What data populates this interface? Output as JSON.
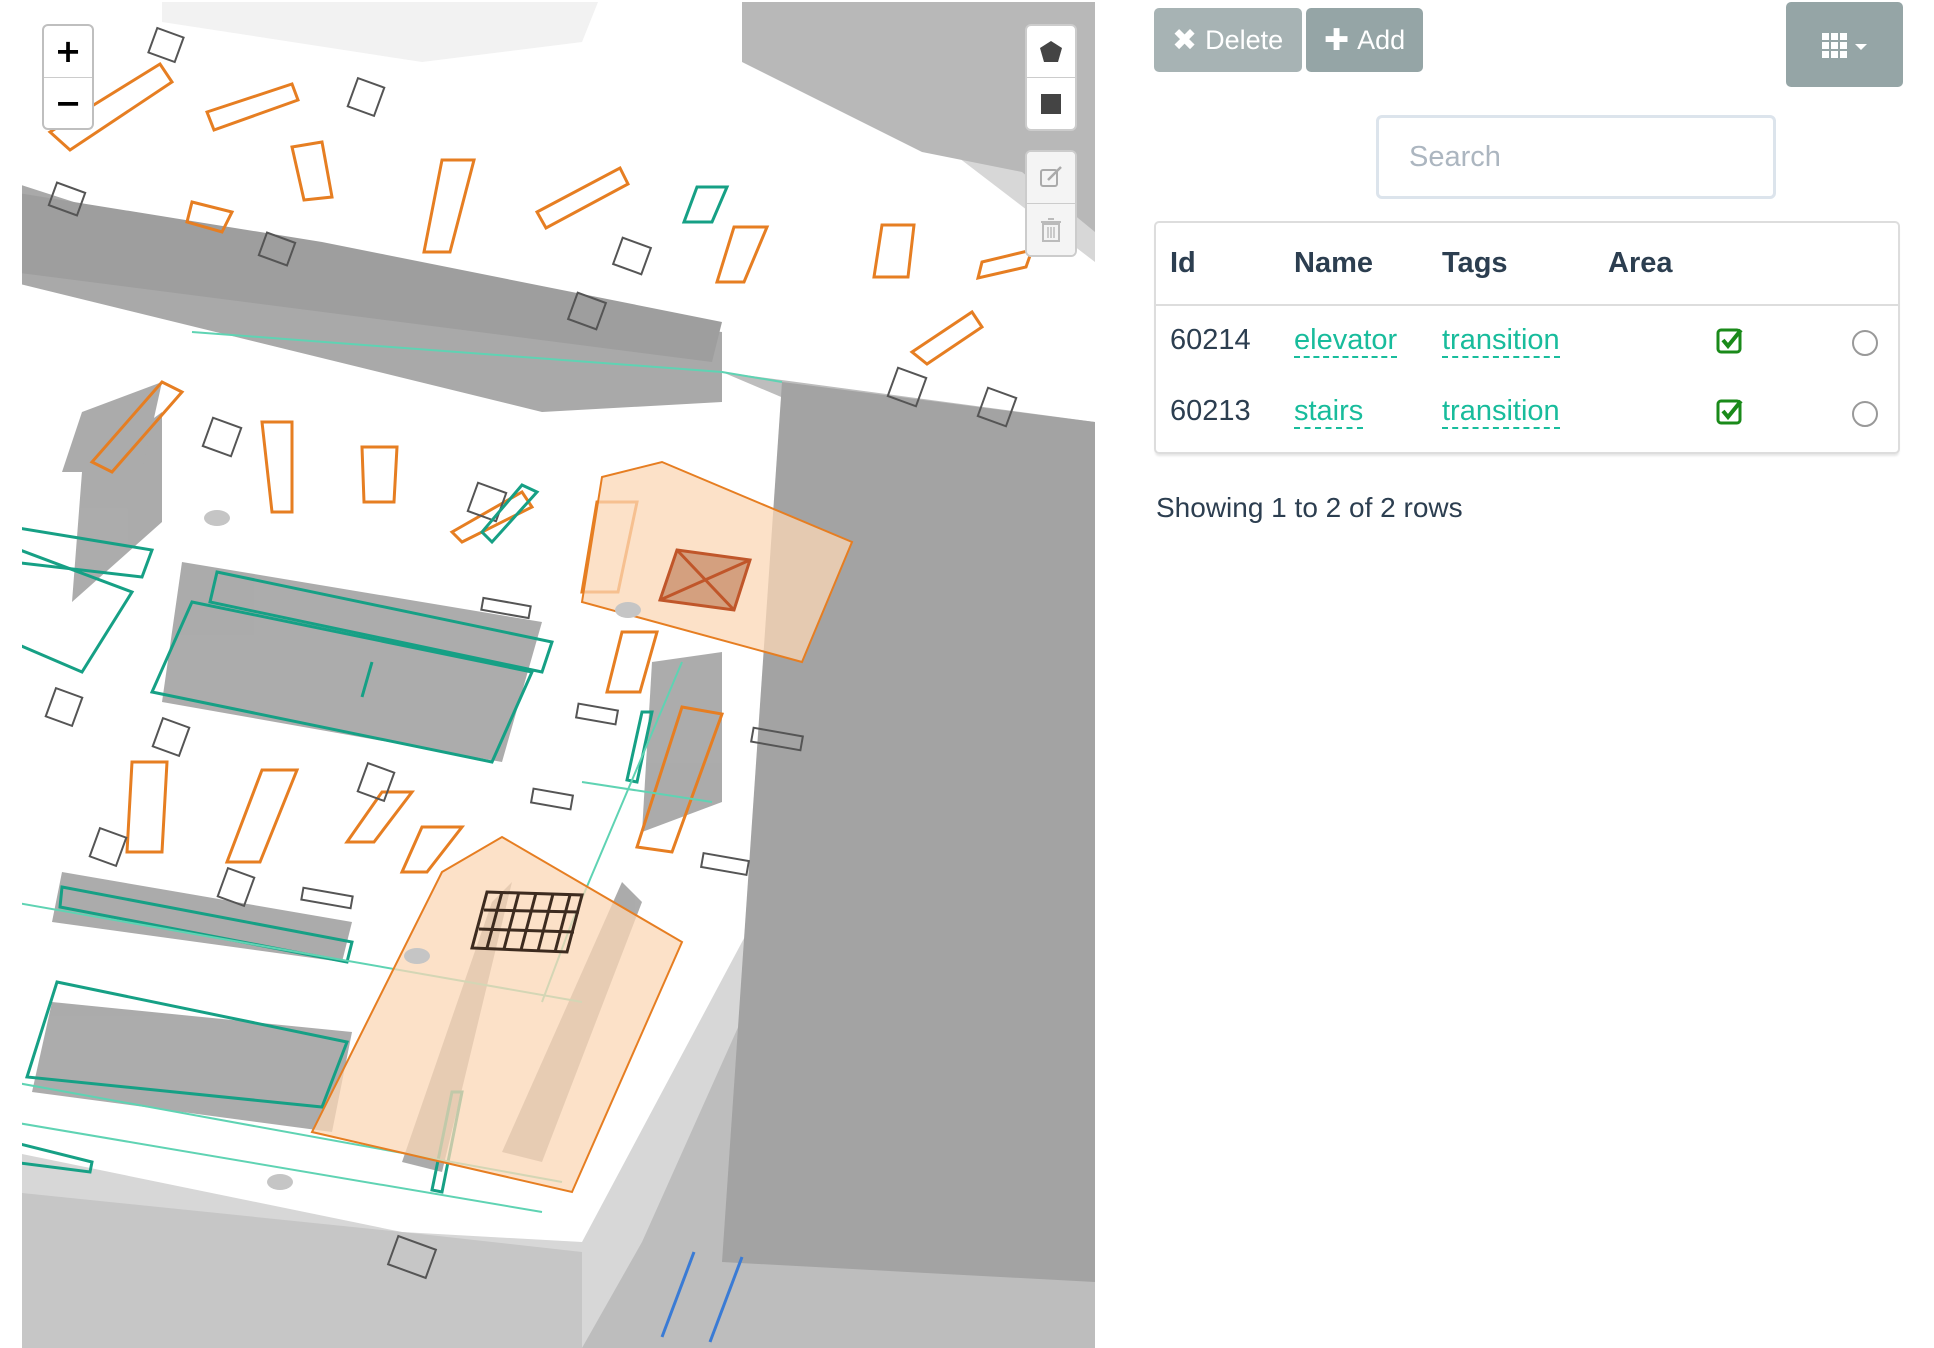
{
  "map": {
    "zoom_in_label": "+",
    "zoom_out_label": "−",
    "draw_tools": [
      "polygon-icon",
      "rectangle-icon"
    ],
    "edit_tools": [
      "edit-layers-icon",
      "delete-layers-icon"
    ]
  },
  "toolbar": {
    "delete_label": "Delete",
    "delete_glyph": "✖",
    "add_label": "Add",
    "add_glyph": "✚",
    "columns_icon": "grid-icon"
  },
  "search": {
    "placeholder": "Search",
    "value": ""
  },
  "table": {
    "headers": [
      "Id",
      "Name",
      "Tags",
      "Area"
    ],
    "rows": [
      {
        "id": "60214",
        "name": "elevator",
        "tags": "transition",
        "area": true
      },
      {
        "id": "60213",
        "name": "stairs",
        "tags": "transition",
        "area": true
      }
    ]
  },
  "pagination": {
    "info": "Showing 1 to 2 of 2 rows"
  },
  "colors": {
    "accent": "#18bc9c",
    "button_gray": "#95a5a6",
    "orange_outline": "#e67e22",
    "green_outline": "#16a085",
    "area_fill": "#fbd7b5"
  }
}
